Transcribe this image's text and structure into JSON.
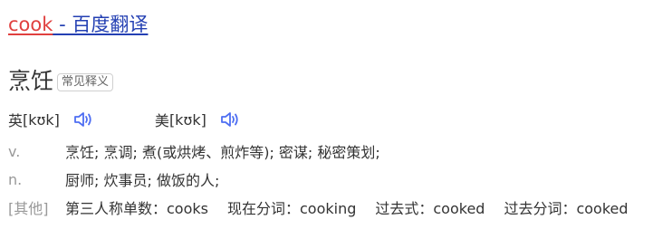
{
  "title": {
    "keyword": "cook",
    "separator": " - ",
    "site": "百度翻译"
  },
  "headword": {
    "text": "烹饪",
    "tag": "常见释义"
  },
  "pronunciation": {
    "uk": {
      "label": "英",
      "phonetic": "[kʊk]"
    },
    "us": {
      "label": "美",
      "phonetic": "[kʊk]"
    },
    "speaker_icon": "speaker-icon",
    "accent_color": "#4e6ef2"
  },
  "definitions": [
    {
      "pos": "v.",
      "text": "烹饪; 烹调; 煮(或烘烤、煎炸等); 密谋; 秘密策划;"
    },
    {
      "pos": "n.",
      "text": "厨师; 炊事员; 做饭的人;"
    }
  ],
  "other": {
    "label": "[其他]",
    "forms": [
      "第三人称单数：cooks",
      "现在分词：cooking",
      "过去式：cooked",
      "过去分词：cooked"
    ]
  },
  "colors": {
    "keyword": "#e0403f",
    "link": "#2440b3",
    "muted": "#999999",
    "text": "#333333"
  }
}
